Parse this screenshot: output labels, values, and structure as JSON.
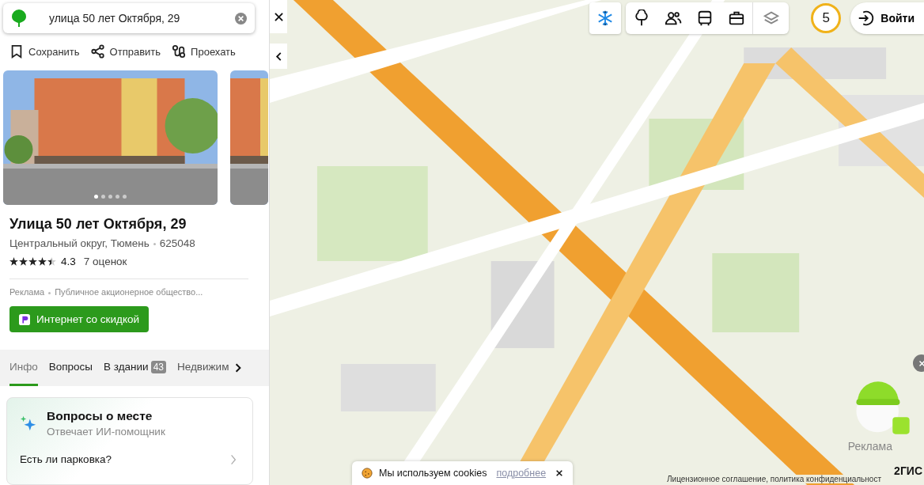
{
  "search": {
    "value": "улица 50 лет Октября, 29"
  },
  "actions": [
    {
      "label": "Сохранить",
      "kind": "save"
    },
    {
      "label": "Отправить",
      "kind": "share"
    },
    {
      "label": "Проехать",
      "kind": "route"
    }
  ],
  "carousel_dots": [
    {
      "selected": true
    },
    {
      "selected": false
    },
    {
      "selected": false
    },
    {
      "selected": false
    },
    {
      "selected": false
    }
  ],
  "place": {
    "title": "Улица 50 лет Октября, 29",
    "district": "Центральный округ, Тюмень",
    "postcode": "625048",
    "stars": 4.5,
    "rating": "4.3",
    "reviews": "7 оценок"
  },
  "ad": {
    "label": "Реклама",
    "advertiser": "Публичное акционерное общество...",
    "button": "Интернет со скидкой"
  },
  "tabs": [
    {
      "label": "Инфо",
      "selected": true
    },
    {
      "label": "Вопросы",
      "selected": false
    },
    {
      "label": "В здании",
      "badge": "43",
      "selected": false
    },
    {
      "label": "Недвижим",
      "selected": false
    }
  ],
  "questions_card": {
    "title": "Вопросы о месте",
    "subtitle": "Отвечает ИИ-помощник",
    "question": "Есть ли парковка?"
  },
  "map_tools": [
    {
      "kind": "tree"
    },
    {
      "kind": "people"
    },
    {
      "kind": "bus"
    },
    {
      "kind": "briefcase"
    },
    {
      "kind": "layers"
    }
  ],
  "notifications": "5",
  "login": "Войти",
  "cookies": {
    "text": "Мы используем cookies",
    "link": "подробнее"
  },
  "map_ad_label": "Реклама",
  "brand": "2ГИС",
  "footer": "Лицензионное соглашение, политика конфиденциальност"
}
